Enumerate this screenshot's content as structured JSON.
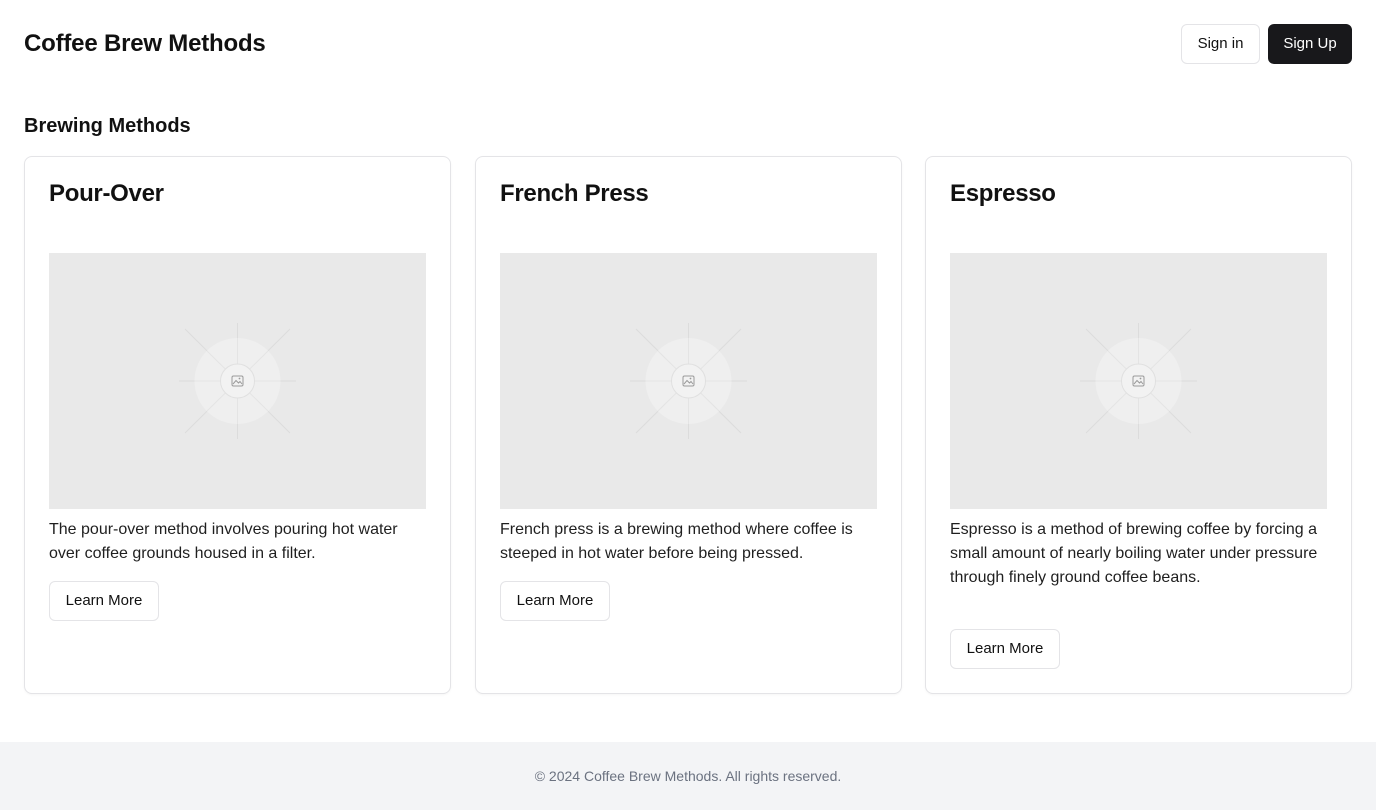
{
  "header": {
    "title": "Coffee Brew Methods",
    "sign_in_label": "Sign in",
    "sign_up_label": "Sign Up"
  },
  "main": {
    "section_title": "Brewing Methods",
    "cards": [
      {
        "title": "Pour-Over",
        "description": "The pour-over method involves pouring hot water over coffee grounds housed in a filter.",
        "button_label": "Learn More",
        "image_icon": "image-placeholder-icon"
      },
      {
        "title": "French Press",
        "description": "French press is a brewing method where coffee is steeped in hot water before being pressed.",
        "button_label": "Learn More",
        "image_icon": "image-placeholder-icon"
      },
      {
        "title": "Espresso",
        "description": "Espresso is a method of brewing coffee by forcing a small amount of nearly boiling water under pressure through finely ground coffee beans.",
        "button_label": "Learn More",
        "image_icon": "image-placeholder-icon"
      }
    ]
  },
  "footer": {
    "copyright": "© 2024 Coffee Brew Methods. All rights reserved."
  },
  "colors": {
    "primary_button": "#18181b",
    "border": "#e4e4e7",
    "image_placeholder": "#e9e9e9",
    "footer_bg": "#f3f4f6",
    "footer_text": "#6b7280"
  }
}
